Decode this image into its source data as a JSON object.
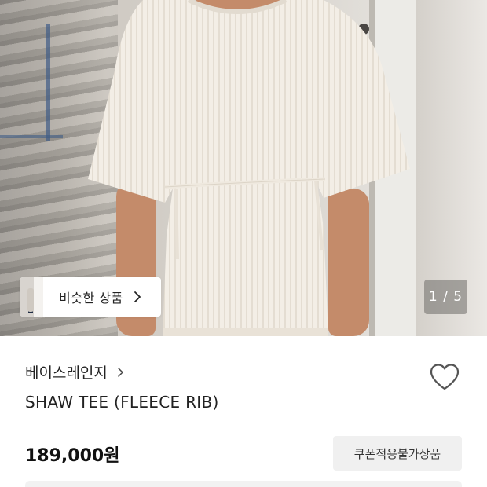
{
  "gallery": {
    "similar_label": "비슷한 상품",
    "page_indicator": "1 / 5"
  },
  "product": {
    "brand": "베이스레인지",
    "name": "SHAW TEE (FLEECE RIB)",
    "price": "189,000원",
    "coupon_label": "쿠폰적용불가상품"
  },
  "icons": {
    "similar_chevron": "chevron-right-icon",
    "brand_chevron": "chevron-right-icon",
    "wishlist": "heart-outline-icon"
  },
  "colors": {
    "tee": "#f3eee6",
    "text": "#222222",
    "coupon_bg": "#f0f0f0"
  }
}
